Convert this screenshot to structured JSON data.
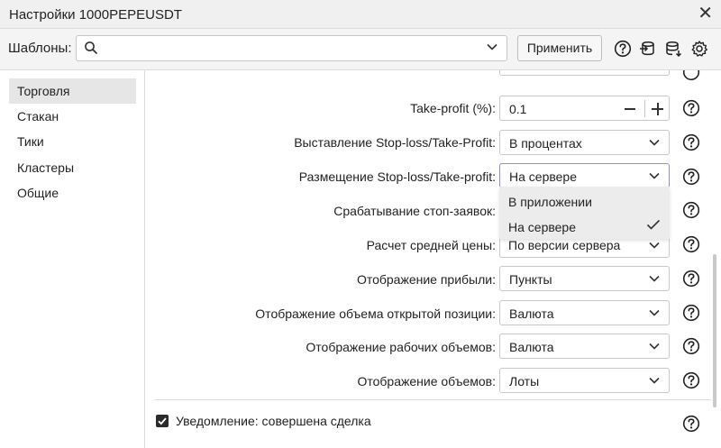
{
  "window": {
    "title": "Настройки 1000PEPEUSDT",
    "close_glyph": "✕"
  },
  "toolbar": {
    "templates_label": "Шаблоны:",
    "search_value": "",
    "apply_label": "Применить",
    "icons": [
      "help-icon",
      "export-icon",
      "database-icon",
      "settings-icon"
    ]
  },
  "sidebar": {
    "items": [
      {
        "label": "Торговля",
        "active": true
      },
      {
        "label": "Стакан",
        "active": false
      },
      {
        "label": "Тики",
        "active": false
      },
      {
        "label": "Кластеры",
        "active": false
      },
      {
        "label": "Общие",
        "active": false
      }
    ]
  },
  "settings": {
    "rows": [
      {
        "label": "Take-profit (%):",
        "value": "0.1",
        "control": "stepper"
      },
      {
        "label": "Выставление Stop-loss/Take-Profit:",
        "value": "В процентах",
        "control": "select"
      },
      {
        "label": "Размещение Stop-loss/Take-profit:",
        "value": "На сервере",
        "control": "select",
        "open": true
      },
      {
        "label": "Срабатывание стоп-заявок:",
        "value": "",
        "control": "select"
      },
      {
        "label": "Расчет средней цены:",
        "value": "По версии сервера",
        "control": "select"
      },
      {
        "label": "Отображение прибыли:",
        "value": "Пункты",
        "control": "select"
      },
      {
        "label": "Отображение объема открытой позиции:",
        "value": "Валюта",
        "control": "select"
      },
      {
        "label": "Отображение рабочих объемов:",
        "value": "Валюта",
        "control": "select"
      },
      {
        "label": "Отображение объемов:",
        "value": "Лоты",
        "control": "select"
      }
    ],
    "dropdown_options": [
      {
        "label": "В приложении",
        "selected": false
      },
      {
        "label": "На сервере",
        "selected": true
      }
    ],
    "notification": {
      "label": "Уведомление: совершена сделка",
      "checked": true
    }
  },
  "colors": {
    "focus_border": "#9a8bc6",
    "active_sidebar": "#e6e6e6",
    "dropdown_bg": "#ececec"
  }
}
